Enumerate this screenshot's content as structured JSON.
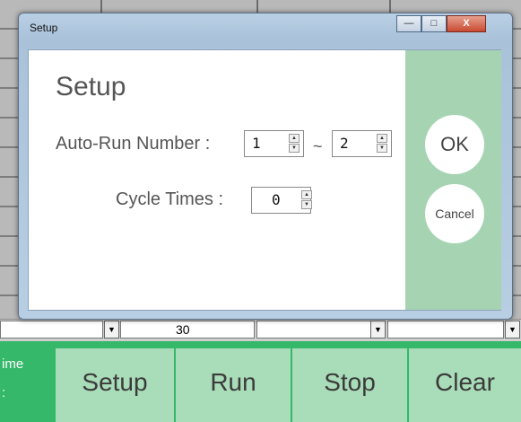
{
  "background": {
    "cell_value": "30",
    "time_label": "ime\n:",
    "buttons": [
      "Setup",
      "Run",
      "Stop",
      "Clear"
    ]
  },
  "dialog": {
    "window_title": "Setup",
    "heading": "Setup",
    "auto_run_label": "Auto-Run Number :",
    "auto_run_from": "1",
    "tilde": "~",
    "auto_run_to": "2",
    "cycle_label": "Cycle Times :",
    "cycle_value": "0",
    "ok_label": "OK",
    "cancel_label": "Cancel",
    "caption": {
      "minimize": "—",
      "maximize": "□",
      "close": "X"
    }
  },
  "icons": {
    "spin_up": "up-arrow",
    "spin_down": "down-arrow",
    "dropdown": "chevron-down"
  },
  "colors": {
    "accent_green": "#35b86a",
    "panel_green": "#a6d4b2",
    "button_green": "#a9dcb8"
  }
}
